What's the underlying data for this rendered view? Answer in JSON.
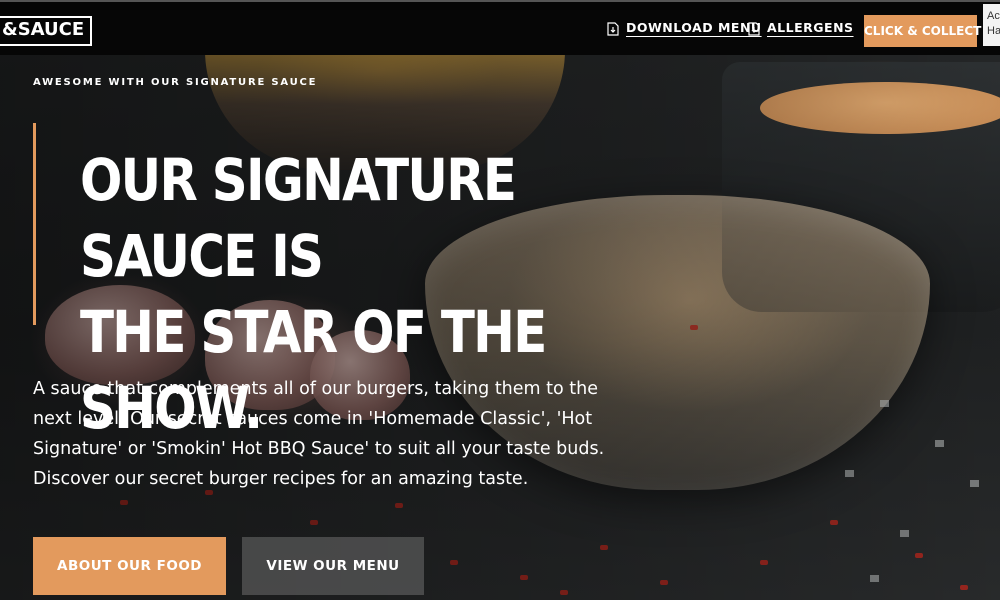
{
  "header": {
    "logo_text": "&SAUCE",
    "nav": [
      {
        "label": "DOWNLOAD MENU",
        "icon": "download-icon"
      },
      {
        "label": "ALLERGENS",
        "icon": "download-icon"
      }
    ],
    "cta_label": "CLICK & COLLECT",
    "accessibility_tab": "Ac Ha"
  },
  "hero": {
    "eyebrow": "AWESOME WITH OUR SIGNATURE SAUCE",
    "headline_line1": "OUR SIGNATURE SAUCE IS",
    "headline_line2": "THE STAR OF THE SHOW.",
    "body": "A sauce that complements all of our burgers, taking them to the next level. Our secret sauces come in 'Homemade Classic', 'Hot Signature' or 'Smokin' Hot BBQ Sauce' to suit all your taste buds. Discover our secret burger recipes for an amazing taste.",
    "buttons": {
      "primary": "ABOUT OUR FOOD",
      "secondary": "VIEW OUR MENU"
    }
  },
  "colors": {
    "accent": "#e39a5d",
    "header_bg": "#060606",
    "text": "#ffffff"
  }
}
